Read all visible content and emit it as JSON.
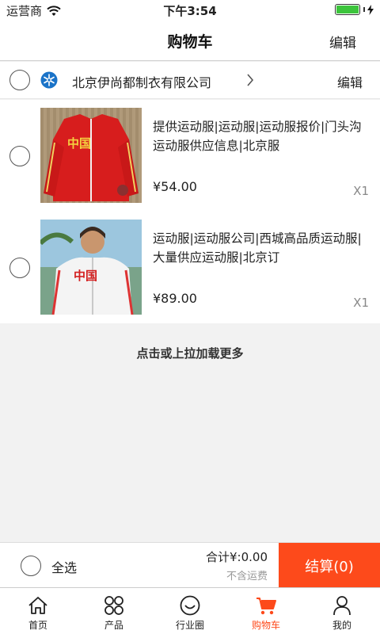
{
  "status_bar": {
    "carrier": "运营商",
    "time": "下午3:54"
  },
  "nav": {
    "title": "购物车",
    "edit_label": "编辑"
  },
  "shop": {
    "name": "北京伊尚都制衣有限公司",
    "edit_label": "编辑"
  },
  "items": [
    {
      "title": "提供运动服|运动服|运动服报价|门头沟运动服供应信息|北京服",
      "price": "¥54.00",
      "qty": "X1"
    },
    {
      "title": "运动服|运动服公司|西城高品质运动服|大量供应运动服|北京订",
      "price": "¥89.00",
      "qty": "X1"
    }
  ],
  "load_more": "点击或上拉加载更多",
  "checkout": {
    "select_all_label": "全选",
    "total": "合计¥:0.00",
    "shipping_note": "不含运费",
    "button_label": "结算(0)"
  },
  "tabs": [
    {
      "label": "首页",
      "icon": "home-icon"
    },
    {
      "label": "产品",
      "icon": "grid-icon"
    },
    {
      "label": "行业圈",
      "icon": "smiley-icon"
    },
    {
      "label": "购物车",
      "icon": "cart-icon",
      "active": true
    },
    {
      "label": "我的",
      "icon": "user-icon"
    }
  ],
  "colors": {
    "accent": "#fd4a1b",
    "battery": "#3cc43c"
  }
}
